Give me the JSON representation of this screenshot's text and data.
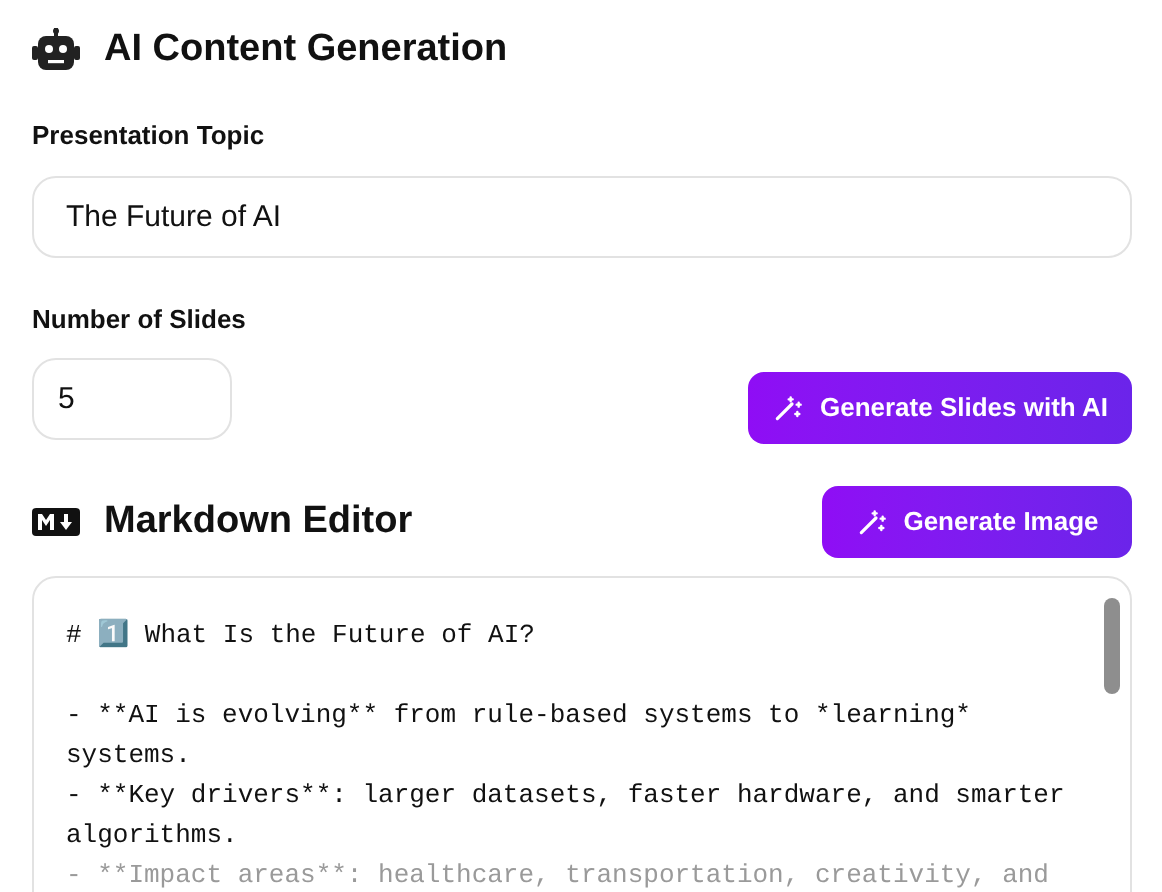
{
  "section_title": "AI Content Generation",
  "topic": {
    "label": "Presentation Topic",
    "value": "The Future of AI"
  },
  "slides": {
    "label": "Number of Slides",
    "value": "5"
  },
  "generate_slides_button": "Generate Slides with AI",
  "editor": {
    "title": "Markdown Editor",
    "generate_image_button": "Generate Image",
    "lines": [
      {
        "kind": "heading",
        "text": "# 1️⃣ What Is the Future of AI?"
      },
      {
        "kind": "item",
        "text": "- **AI is evolving** from rule-based systems to *learning* systems."
      },
      {
        "kind": "item",
        "text": "- **Key drivers**: larger datasets, faster hardware, and smarter algorithms."
      },
      {
        "kind": "item",
        "text": "- **Impact areas**: healthcare, transportation, creativity, and"
      }
    ]
  }
}
